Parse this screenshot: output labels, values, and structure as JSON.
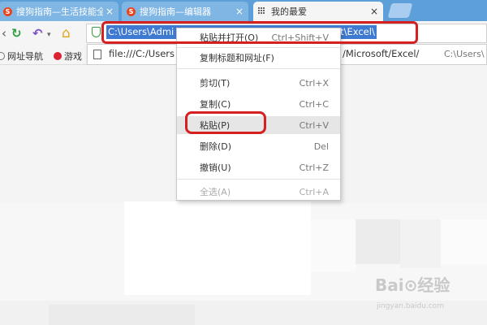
{
  "tabs": [
    {
      "title": "搜狗指南—生活技能全",
      "close": "×",
      "favicon": "S"
    },
    {
      "title": "搜狗指南—编辑器",
      "close": "×",
      "favicon": "S"
    },
    {
      "title": "我的最爱",
      "close": "×",
      "favicon": "grid-icon"
    }
  ],
  "toolbar": {
    "back_icon": "‹",
    "refresh_icon": "↻",
    "undo_icon": "↶",
    "dropdown_icon": "▾",
    "home_icon": "⌂"
  },
  "address_bar": {
    "value_left": "C:\\Users\\Admi",
    "value_right": "soft\\Excel\\"
  },
  "suggestion": {
    "url": "file:///C:/Users",
    "url_tail": "/Microsoft/Excel/",
    "hint": "C:\\Users\\"
  },
  "bookmarks": [
    {
      "label": "网址导航"
    },
    {
      "label": "游戏"
    }
  ],
  "context_menu": {
    "items": [
      {
        "label": "粘贴并打开(O)",
        "shortcut": "Ctrl+Shift+V"
      },
      {
        "label": "复制标题和网址(F)",
        "shortcut": ""
      },
      {
        "label": "剪切(T)",
        "shortcut": "Ctrl+X"
      },
      {
        "label": "复制(C)",
        "shortcut": "Ctrl+C"
      },
      {
        "label": "粘贴(P)",
        "shortcut": "Ctrl+V"
      },
      {
        "label": "删除(D)",
        "shortcut": "Del"
      },
      {
        "label": "撤销(U)",
        "shortcut": "Ctrl+Z"
      },
      {
        "label": "全选(A)",
        "shortcut": "Ctrl+A"
      }
    ]
  },
  "watermark": {
    "logo": "Bai⊙经验",
    "url": "jingyan.baidu.com"
  },
  "colors": {
    "tabstrip": "#5d9fd8",
    "selection": "#3e7ad1",
    "annotation_red": "#d42020",
    "refresh_green": "#2e9e3a",
    "undo_purple": "#7a4fc9",
    "home_orange": "#e3a21a"
  }
}
